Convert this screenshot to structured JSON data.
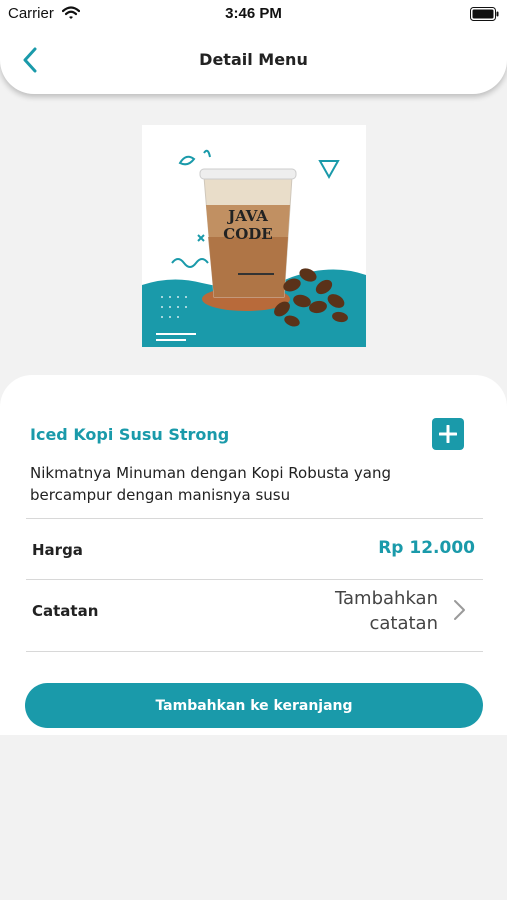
{
  "status_bar": {
    "carrier": "Carrier",
    "time": "3:46 PM"
  },
  "header": {
    "title": "Detail Menu"
  },
  "product": {
    "name": "Iced Kopi Susu Strong",
    "description": "Nikmatnya Minuman dengan Kopi Robusta yang bercampur dengan manisnya susu",
    "image_logo_text": [
      "JAVA",
      "CODE"
    ]
  },
  "price_row": {
    "label": "Harga",
    "value": "Rp 12.000"
  },
  "note_row": {
    "label": "Catatan",
    "placeholder_line1": "Tambahkan",
    "placeholder_line2": "catatan"
  },
  "cta": {
    "label": "Tambahkan ke keranjang"
  },
  "icons": [
    "wifi-icon",
    "battery-icon",
    "back-arrow-icon",
    "plus-icon",
    "chevron-right-icon"
  ],
  "colors": {
    "accent": "#1a9aaa",
    "background": "#f2f2f2",
    "surface": "#ffffff"
  }
}
